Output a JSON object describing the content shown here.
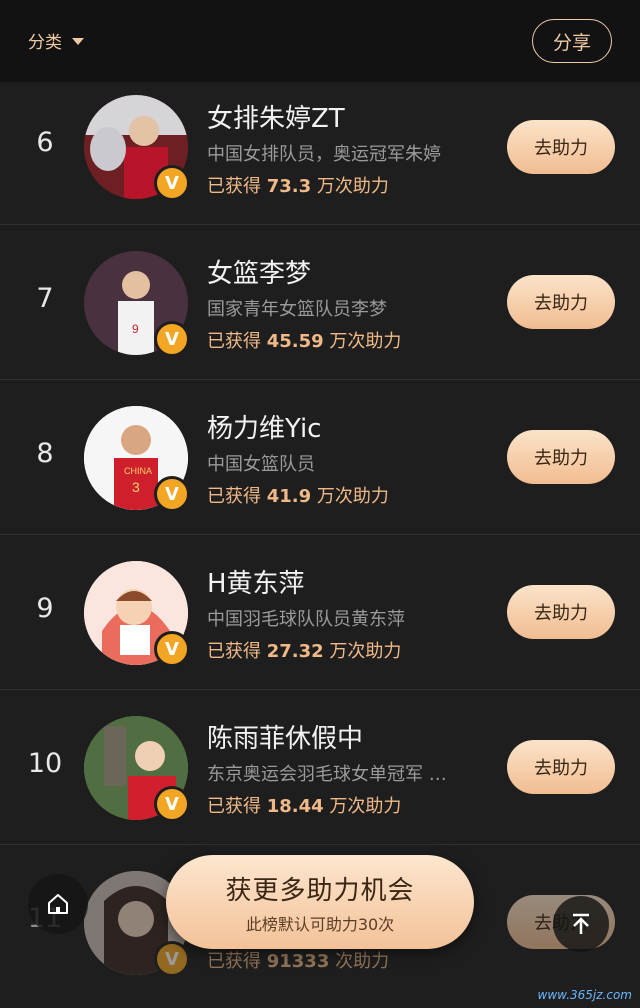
{
  "header": {
    "category_label": "分类",
    "share_label": "分享"
  },
  "help_label": "去助力",
  "votes_prefix": "已获得",
  "rows": [
    {
      "rank": "6",
      "name": "女排朱婷ZT",
      "desc": "中国女排队员，奥运冠军朱婷",
      "count": "73.3",
      "unit": "万次助力",
      "badge": "V"
    },
    {
      "rank": "7",
      "name": "女篮李梦",
      "desc": "国家青年女篮队员李梦",
      "count": "45.59",
      "unit": "万次助力",
      "badge": "V"
    },
    {
      "rank": "8",
      "name": "杨力维Yic",
      "desc": "中国女篮队员",
      "count": "41.9",
      "unit": "万次助力",
      "badge": "V"
    },
    {
      "rank": "9",
      "name": "H黄东萍",
      "desc": "中国羽毛球队队员黄东萍",
      "count": "27.32",
      "unit": "万次助力",
      "badge": "V"
    },
    {
      "rank": "10",
      "name": "陈雨菲休假中",
      "desc": "东京奥运会羽毛球女单冠军 …",
      "count": "18.44",
      "unit": "万次助力",
      "badge": "V"
    },
    {
      "rank": "11",
      "name": "",
      "desc": "",
      "count": "91333",
      "unit": "次助力",
      "badge": "V"
    }
  ],
  "floating": {
    "title": "获更多助力机会",
    "subtitle": "此榜默认可助力30次"
  },
  "watermark": "www.365jz.com",
  "colors": {
    "accent": "#f0c9a3",
    "badge": "#f3a623",
    "button": "#f1bd91"
  },
  "icons": [
    "caret-down-icon",
    "home-icon",
    "arrow-up-icon",
    "verified-v-icon"
  ]
}
